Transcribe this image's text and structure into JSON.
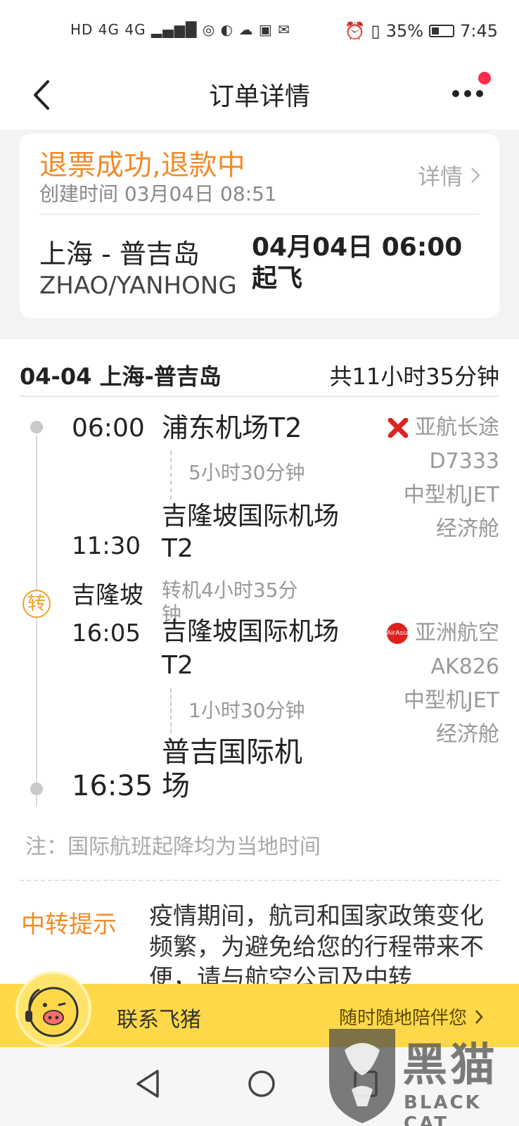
{
  "status_bar": {
    "left_icons": "HD 4G 4G",
    "battery": "35%",
    "time": "7:45"
  },
  "nav": {
    "title": "订单详情"
  },
  "order": {
    "status": "退票成功,退款中",
    "created": "创建时间 03月04日 08:51",
    "detail_link": "详情",
    "route": "上海 - 普吉岛",
    "passenger": "ZHAO/YANHONG",
    "departure": "04月04日 06:00起飞"
  },
  "trip": {
    "date_route": "04-04 上海-普吉岛",
    "total_duration": "共11小时35分钟",
    "legs": [
      {
        "dep_time": "06:00",
        "dep_airport": "浦东机场T2",
        "flight_duration": "5小时30分钟",
        "arr_airport_line1": "吉隆坡国际机场",
        "arr_airport_line2": "T2",
        "arr_time": "11:30",
        "airline": "亚航长途",
        "flight_no": "D7333",
        "aircraft": "中型机JET",
        "cabin": "经济舱",
        "logo_color": "#e02020"
      },
      {
        "dep_time": "16:05",
        "dep_airport_line1": "吉隆坡国际机场",
        "dep_airport_line2": "T2",
        "flight_duration": "1小时30分钟",
        "arr_airport_line1": "普吉国际机",
        "arr_airport_line2": "场",
        "arr_time": "16:35",
        "airline": "亚洲航空",
        "flight_no": "AK826",
        "aircraft": "中型机JET",
        "cabin": "经济舱",
        "logo_color": "#e02020"
      }
    ],
    "transfer": {
      "badge": "转",
      "city": "吉隆坡",
      "layover": "转机4小时35分钟"
    }
  },
  "note": "注：国际航班起降均为当地时间",
  "transfer_tip": {
    "label": "中转提示",
    "text": "疫情期间，航司和国家政策变化频繁，为避免给您的行程带来不便，请与航空公司及中转"
  },
  "contact": {
    "label": "联系飞猪",
    "slogan": "随时随地陪伴您"
  },
  "watermark": {
    "name": "黑猫",
    "sub": "BLACK CAT"
  }
}
